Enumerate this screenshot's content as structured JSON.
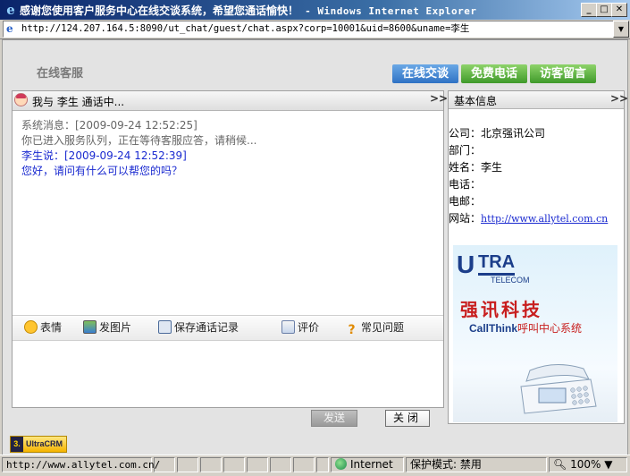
{
  "window": {
    "title_zh": "感谢您使用客户服务中心在线交谈系统，希望您通话愉快！",
    "title_sep": " - ",
    "title_app": "Windows Internet Explorer",
    "minimize": "_",
    "maximize": "□",
    "close": "✕"
  },
  "address": {
    "url": "http://124.207.164.5:8090/ut_chat/guest/chat.aspx?corp=10001&uid=8600&uname=李生",
    "dropdown": "▼"
  },
  "header": {
    "logo_text": "在线客服",
    "tabs": [
      {
        "label": "在线交谈"
      },
      {
        "label": "免费电话"
      },
      {
        "label": "访客留言"
      }
    ]
  },
  "chat": {
    "header_title": "我与 李生 通话中...",
    "collapse": ">>",
    "messages": [
      {
        "text": "系统消息：[2009-09-24 12:52:25]"
      },
      {
        "text": "你已进入服务队列，正在等待客服应答，请稍候..."
      },
      {
        "text": "李生说：[2009-09-24 12:52:39]"
      },
      {
        "text": "您好，请问有什么可以帮您的吗？"
      }
    ],
    "toolbar": {
      "emoji": "表情",
      "send_image": "发图片",
      "save_record": "保存通话记录",
      "rate": "评价",
      "faq_icon": "?",
      "faq": "常见问题"
    },
    "send_label": "发送",
    "close_label": "关闭"
  },
  "info": {
    "title": "基本信息",
    "collapse": ">>",
    "rows": [
      {
        "label": "公司：",
        "value": "北京强讯公司"
      },
      {
        "label": "部门：",
        "value": ""
      },
      {
        "label": "姓名：",
        "value": "李生"
      },
      {
        "label": "电话：",
        "value": ""
      },
      {
        "label": "电邮：",
        "value": ""
      },
      {
        "label": "网站：",
        "value": "http://www.allytel.com.cn"
      }
    ],
    "ad": {
      "u": "U",
      "tra": "TRA",
      "telecom": "TELECOM",
      "cn_name": "强讯科技",
      "product": "CallThink",
      "product_suffix": "呼叫中心系统"
    }
  },
  "brand": {
    "num": "3.",
    "name": "UltraCRM"
  },
  "status": {
    "url": "http://www.allytel.com.cn/",
    "zone": "Internet",
    "protected": "保护模式: 禁用",
    "zoom": "100%",
    "zoom_arrow": "▼"
  }
}
